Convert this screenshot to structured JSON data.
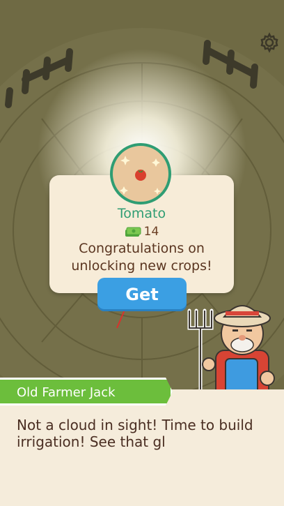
{
  "settings": {
    "icon": "gear-icon"
  },
  "reward": {
    "crop_name": "Tomato",
    "currency_icon": "cash-icon",
    "amount": "14",
    "message_line1": "Congratulations on",
    "message_line2": "unlocking new crops!",
    "get_label": "Get"
  },
  "dialog": {
    "speaker": "Old Farmer Jack",
    "text_line1": "Not a cloud in sight! Time to build",
    "text_line2": "irrigation! See that gl"
  },
  "colors": {
    "accent_green": "#2f9d73",
    "button_blue": "#3b9fe3",
    "name_tag_green": "#6cbe3c"
  }
}
